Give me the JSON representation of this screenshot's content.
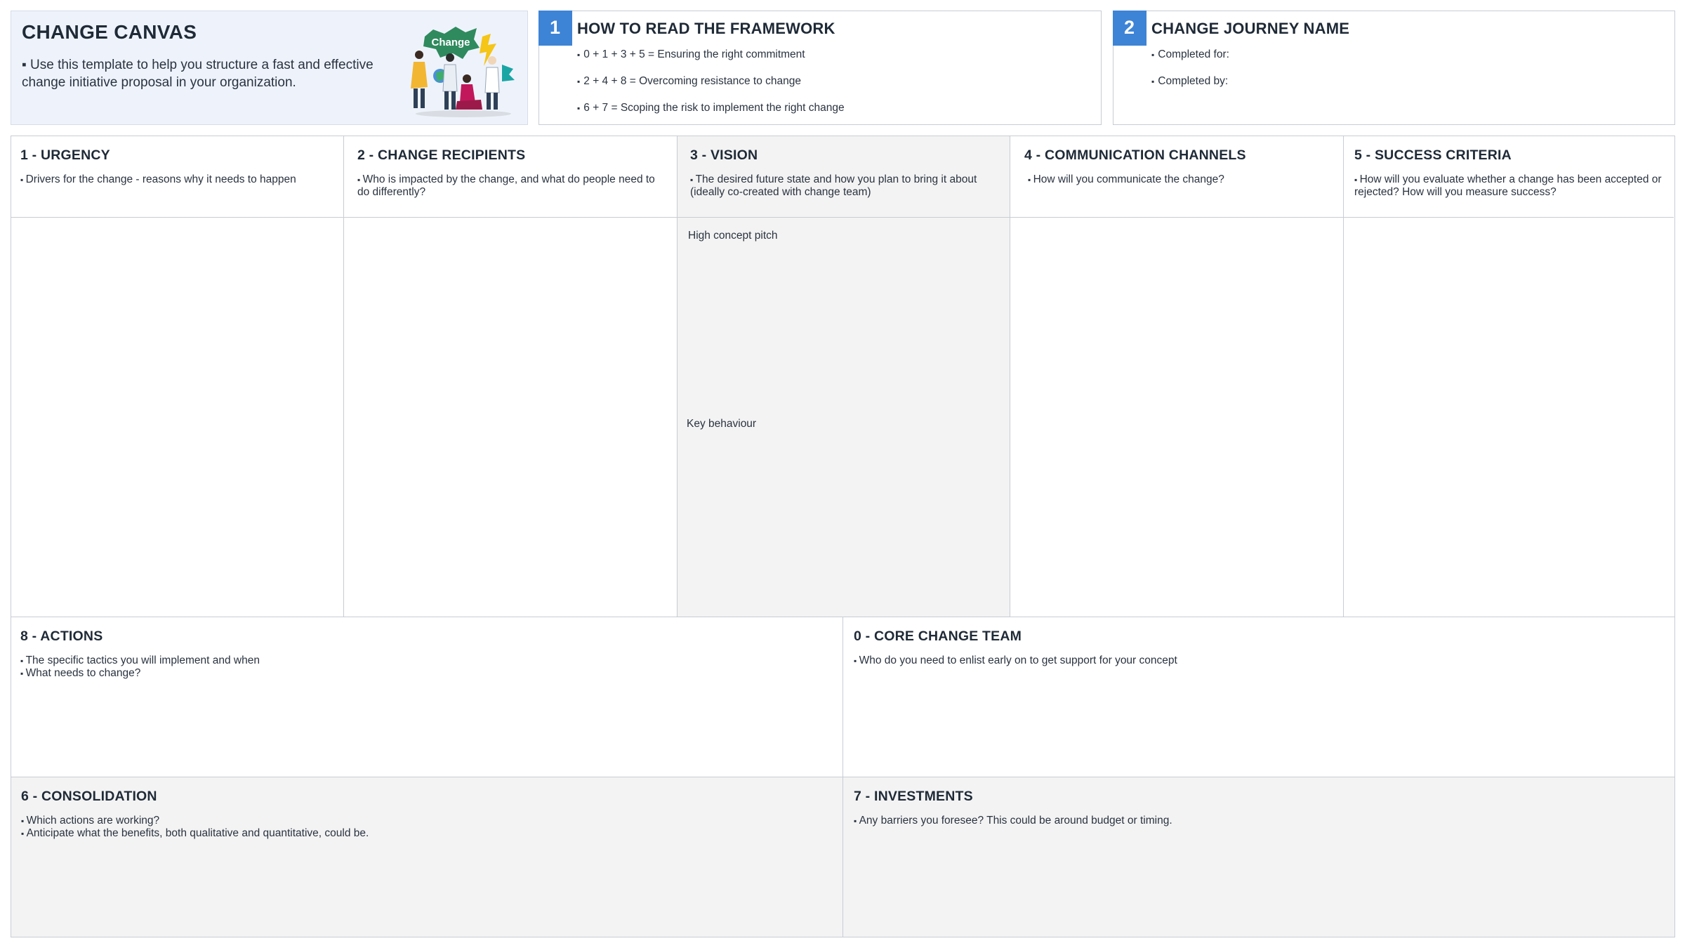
{
  "intro": {
    "title": "CHANGE CANVAS",
    "text": "▪ Use this template to help you structure a fast and effective change initiative proposal in your organization.",
    "illustration_label": "Change"
  },
  "framework": {
    "number": "1",
    "title": "HOW TO READ THE FRAMEWORK",
    "items": [
      "0 + 1 + 3 + 5 = Ensuring the right commitment",
      "2 + 4 + 8 = Overcoming resistance to change",
      "6 + 7 = Scoping the risk to implement the right change"
    ]
  },
  "journey": {
    "number": "2",
    "title": "CHANGE JOURNEY NAME",
    "items": [
      "Completed for:",
      "Completed by:"
    ]
  },
  "columns": [
    {
      "title": "1 - URGENCY",
      "desc": "Drivers for the change - reasons why it needs to happen"
    },
    {
      "title": "2 - CHANGE RECIPIENTS",
      "desc": "Who is impacted by the change, and what do people need to do differently?"
    },
    {
      "title": "3 - VISION",
      "desc": "The desired future state and how you plan to bring it about (ideally co-created with change team)",
      "notes": [
        "High concept pitch",
        "Key behaviour"
      ]
    },
    {
      "title": "4 - COMMUNICATION CHANNELS",
      "desc": "How will you communicate the change?"
    },
    {
      "title": "5 - SUCCESS CRITERIA",
      "desc": "How will you evaluate whether a change has been accepted or rejected? How will you measure success?"
    }
  ],
  "actions": {
    "title": "8 - ACTIONS",
    "items": [
      "The specific tactics you will implement and when",
      "What needs to change?"
    ]
  },
  "core_team": {
    "title": "0 - CORE CHANGE TEAM",
    "items": [
      "Who do you need to enlist early on to get support for your concept"
    ]
  },
  "consolidation": {
    "title": "6 - CONSOLIDATION",
    "items": [
      "Which actions are working?",
      "Anticipate what the benefits, both qualitative and quantitative, could be."
    ]
  },
  "investments": {
    "title": "7 - INVESTMENTS",
    "items": [
      "Any barriers you foresee? This could be around budget or timing."
    ]
  },
  "colors": {
    "accent": "#3d84d6",
    "shade": "#f3f3f3",
    "intro_bg": "#eef3fb",
    "border": "#c8ccd2"
  }
}
